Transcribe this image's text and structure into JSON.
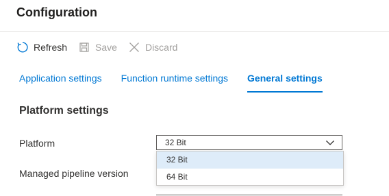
{
  "title": "Configuration",
  "toolbar": {
    "refresh_label": "Refresh",
    "save_label": "Save",
    "discard_label": "Discard"
  },
  "tabs": [
    {
      "label": "Application settings"
    },
    {
      "label": "Function runtime settings"
    },
    {
      "label": "General settings",
      "active": true
    }
  ],
  "section": {
    "title": "Platform settings",
    "platform_label": "Platform",
    "pipeline_label": "Managed pipeline version"
  },
  "platform_dropdown": {
    "value": "32 Bit",
    "options": [
      "32 Bit",
      "64 Bit"
    ],
    "selected_index": 0
  },
  "colors": {
    "accent": "#0078d4",
    "selected_option_bg": "#deecf9",
    "disabled_text": "#a19f9d"
  },
  "icons": {
    "refresh": "refresh-icon",
    "save": "save-icon",
    "discard": "close-icon",
    "dropdown": "chevron-down-icon"
  }
}
